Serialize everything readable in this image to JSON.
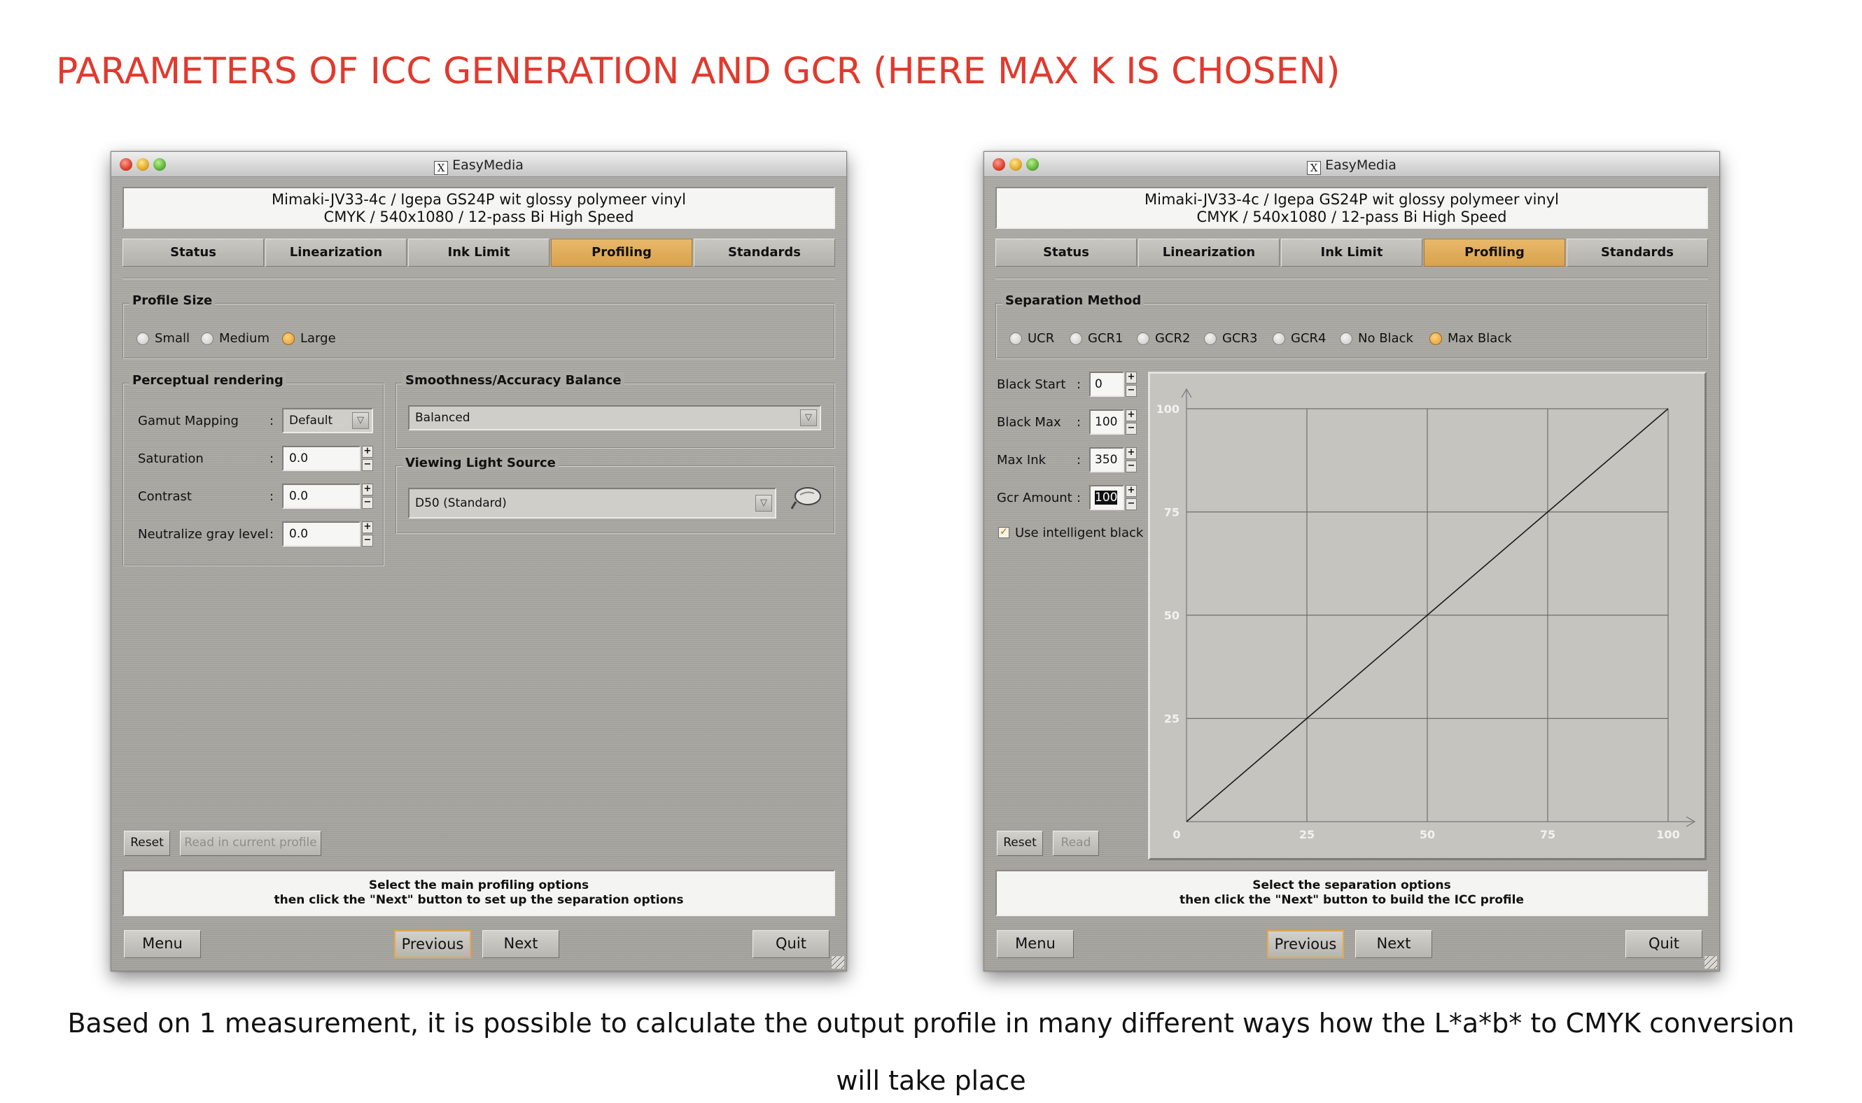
{
  "slide": {
    "title": "PARAMETERS OF ICC GENERATION AND GCR (HERE MAX K IS CHOSEN)",
    "caption_line1": "Based on 1 measurement, it is possible to calculate the output profile in many different ways how the L*a*b* to CMYK conversion",
    "caption_line2": "will take place"
  },
  "left_window": {
    "title": "EasyMedia",
    "title_icon": "X",
    "header_line1": "Mimaki-JV33-4c / Igepa GS24P wit glossy polymeer vinyl",
    "header_line2": "CMYK / 540x1080 / 12-pass Bi High Speed",
    "tabs": [
      {
        "label": "Status",
        "active": false
      },
      {
        "label": "Linearization",
        "active": false
      },
      {
        "label": "Ink Limit",
        "active": false
      },
      {
        "label": "Profiling",
        "active": true
      },
      {
        "label": "Standards",
        "active": false
      }
    ],
    "profile_size": {
      "label": "Profile Size",
      "options": [
        "Small",
        "Medium",
        "Large"
      ],
      "selected": "Large"
    },
    "perceptual": {
      "label": "Perceptual rendering",
      "gamut_mapping_label": "Gamut Mapping",
      "gamut_mapping_value": "Default",
      "saturation_label": "Saturation",
      "saturation_value": "0.0",
      "contrast_label": "Contrast",
      "contrast_value": "0.0",
      "neutralize_label": "Neutralize gray level",
      "neutralize_value": "0.0"
    },
    "smoothness": {
      "label": "Smoothness/Accuracy Balance",
      "value": "Balanced"
    },
    "light_source": {
      "label": "Viewing Light Source",
      "value": "D50 (Standard)"
    },
    "reset_label": "Reset",
    "read_profile_label": "Read in current profile",
    "status_line1": "Select the main profiling options",
    "status_line2": "then click the \"Next\" button to set up the separation options",
    "menu_label": "Menu",
    "previous_label": "Previous",
    "next_label": "Next",
    "quit_label": "Quit"
  },
  "right_window": {
    "title": "EasyMedia",
    "title_icon": "X",
    "header_line1": "Mimaki-JV33-4c / Igepa GS24P wit glossy polymeer vinyl",
    "header_line2": "CMYK / 540x1080 / 12-pass Bi High Speed",
    "tabs": [
      {
        "label": "Status",
        "active": false
      },
      {
        "label": "Linearization",
        "active": false
      },
      {
        "label": "Ink Limit",
        "active": false
      },
      {
        "label": "Profiling",
        "active": true
      },
      {
        "label": "Standards",
        "active": false
      }
    ],
    "separation": {
      "label": "Separation Method",
      "options": [
        "UCR",
        "GCR1",
        "GCR2",
        "GCR3",
        "GCR4",
        "No Black",
        "Max Black"
      ],
      "selected": "Max Black"
    },
    "params": [
      {
        "label": "Black Start",
        "value": "0"
      },
      {
        "label": "Black Max",
        "value": "100"
      },
      {
        "label": "Max Ink",
        "value": "350"
      },
      {
        "label": "Gcr Amount",
        "value": "100"
      }
    ],
    "intelligent_black_label": "Use intelligent black",
    "intelligent_black_checked": true,
    "reset_label": "Reset",
    "read_label": "Read",
    "status_line1": "Select the separation options",
    "status_line2": "then click the \"Next\" button to build the ICC profile",
    "menu_label": "Menu",
    "previous_label": "Previous",
    "next_label": "Next",
    "quit_label": "Quit"
  },
  "chart_data": {
    "type": "line",
    "title": "",
    "xlabel": "",
    "ylabel": "",
    "xlim": [
      0,
      100
    ],
    "ylim": [
      0,
      100
    ],
    "x_ticks": [
      "0",
      "25",
      "50",
      "75",
      "100"
    ],
    "y_ticks": [
      "25",
      "50",
      "75",
      "100"
    ],
    "grid": true,
    "series": [
      {
        "x": [
          0,
          25,
          50,
          75,
          100
        ],
        "values": [
          0,
          25,
          50,
          75,
          100
        ]
      }
    ],
    "line_color": "#1a1a1a"
  }
}
